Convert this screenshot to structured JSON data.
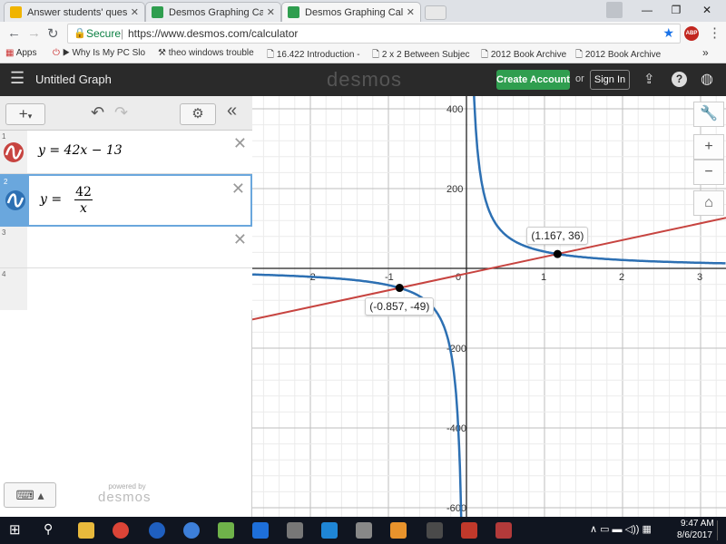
{
  "browser": {
    "tabs": [
      {
        "label": "Answer students' questio",
        "favicon_color": "#f0b400"
      },
      {
        "label": "Desmos Graphing Calcul",
        "favicon_color": "#2f9e4f"
      },
      {
        "label": "Desmos Graphing Calcul",
        "favicon_color": "#2f9e4f"
      }
    ],
    "secure_label": "Secure",
    "url": "https://www.desmos.com/calculator",
    "bookmarks": [
      {
        "label": "Apps",
        "icon": "apps-grid-icon"
      },
      {
        "label": "▶ Why Is My PC Slo",
        "icon": "power-icon"
      },
      {
        "label": "theo windows trouble",
        "icon": "tool-icon"
      },
      {
        "label": "16.422 Introduction -",
        "icon": "page-icon"
      },
      {
        "label": "2 x 2 Between Subjec",
        "icon": "page-icon"
      },
      {
        "label": "2012 Book Archive",
        "icon": "page-icon"
      },
      {
        "label": "2012 Book Archive",
        "icon": "page-icon"
      }
    ],
    "abp_label": "ABP"
  },
  "header": {
    "title": "Untitled Graph",
    "logo": "desmos",
    "create_account": "Create Account",
    "or": "or",
    "sign_in": "Sign In"
  },
  "expressions": [
    {
      "index": "1",
      "text": "y  =  42x  −  13",
      "color": "#c74440"
    },
    {
      "index": "2",
      "lhs": "y  =",
      "numerator": "42",
      "denominator": "x",
      "color": "#2d70b3"
    },
    {
      "index": "3"
    },
    {
      "index": "4"
    }
  ],
  "powered_by": "powered by",
  "powered_logo": "desmos",
  "graph": {
    "x_ticks": [
      "-2",
      "-1",
      "0",
      "1",
      "2",
      "3"
    ],
    "y_ticks": [
      "400",
      "200",
      "-200",
      "-400",
      "-600"
    ],
    "points": [
      {
        "label": "(1.167, 36)",
        "x": 1.167,
        "y": 36
      },
      {
        "label": "(-0.857, -49)",
        "x": -0.857,
        "y": -49
      }
    ],
    "line_color": "#c74440",
    "curve_color": "#2d70b3"
  },
  "chart_data": {
    "type": "line",
    "series": [
      {
        "formula": "y=42x-13",
        "color": "#c74440"
      },
      {
        "formula": "y=42/x",
        "color": "#2d70b3"
      }
    ],
    "xlim": [
      -2.75,
      3.2
    ],
    "ylim": [
      -620,
      420
    ],
    "grid": true
  },
  "taskbar": {
    "time": "9:47 AM",
    "date": "8/6/2017"
  }
}
